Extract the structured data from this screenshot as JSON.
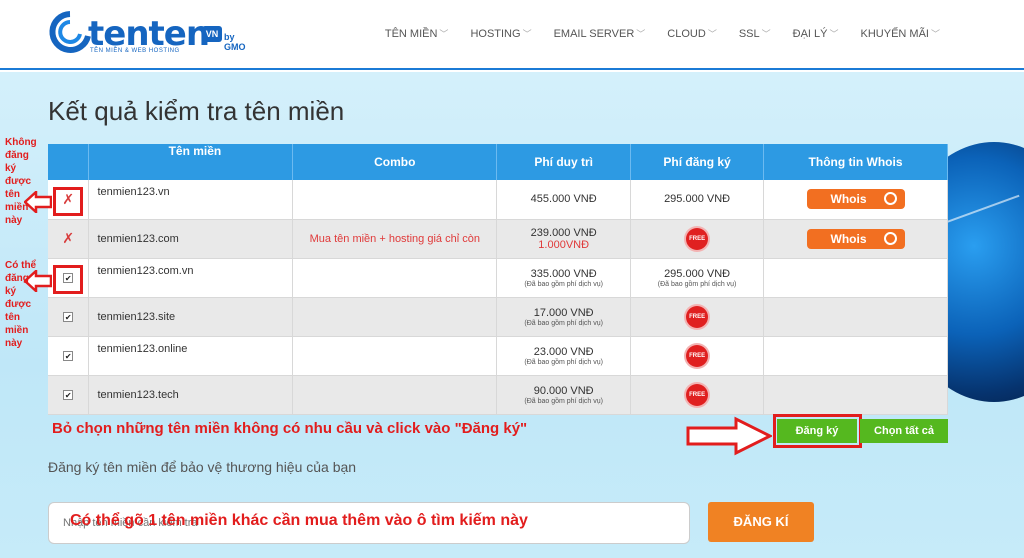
{
  "brand": {
    "logo_text": "tenten",
    "logo_badge": "VN",
    "logo_gmo": "by GMO",
    "tagline": "TÊN MIỀN & WEB HOSTING"
  },
  "nav": [
    {
      "label": "TÊN MIỀN"
    },
    {
      "label": "HOSTING"
    },
    {
      "label": "EMAIL SERVER"
    },
    {
      "label": "CLOUD"
    },
    {
      "label": "SSL"
    },
    {
      "label": "ĐẠI LÝ"
    },
    {
      "label": "KHUYẾN MÃI"
    }
  ],
  "page_title": "Kết quả kiểm tra tên miền",
  "table": {
    "headers": [
      "",
      "Tên miền",
      "Combo",
      "Phí duy trì",
      "Phí đăng ký",
      "Thông tin Whois"
    ],
    "rows": [
      {
        "status": "unavailable",
        "domain": "tenmien123.vn",
        "combo": "",
        "fee": "455.000 VNĐ",
        "fee_note": "",
        "fee2": "",
        "reg": "295.000 VNĐ",
        "reg_note": "",
        "free": false,
        "whois": "Whois"
      },
      {
        "status": "unavailable",
        "domain": "tenmien123.com",
        "combo": "Mua tên miền + hosting giá chỉ còn",
        "fee": "239.000 VNĐ",
        "fee_note": "",
        "fee2": "1.000VNĐ",
        "reg": "",
        "reg_note": "",
        "free": true,
        "free_label": "FREE",
        "whois": "Whois"
      },
      {
        "status": "available",
        "domain": "tenmien123.com.vn",
        "combo": "",
        "fee": "335.000 VNĐ",
        "fee_note": "(Đã bao gồm phí dịch vụ)",
        "fee2": "",
        "reg": "295.000 VNĐ",
        "reg_note": "(Đã bao gồm phí dịch vụ)",
        "free": false,
        "whois": ""
      },
      {
        "status": "available",
        "domain": "tenmien123.site",
        "combo": "",
        "fee": "17.000 VNĐ",
        "fee_note": "(Đã bao gồm phí dịch vụ)",
        "fee2": "",
        "reg": "",
        "reg_note": "",
        "free": true,
        "free_label": "FREE",
        "whois": ""
      },
      {
        "status": "available",
        "domain": "tenmien123.online",
        "combo": "",
        "fee": "23.000 VNĐ",
        "fee_note": "(Đã bao gồm phí dịch vụ)",
        "fee2": "",
        "reg": "",
        "reg_note": "",
        "free": true,
        "free_label": "FREE",
        "whois": ""
      },
      {
        "status": "available",
        "domain": "tenmien123.tech",
        "combo": "",
        "fee": "90.000 VNĐ",
        "fee_note": "(Đã bao gồm phí dịch vụ)",
        "fee2": "",
        "reg": "",
        "reg_note": "",
        "free": true,
        "free_label": "FREE",
        "whois": ""
      }
    ]
  },
  "annotations": {
    "not_available": "Không đăng ký được tên miền này",
    "available": "Có thể đăng ký được tên miền này",
    "instruction": "Bỏ chọn những tên miền không có nhu cầu và click vào \"Đăng ký\"",
    "search_hint": "Có thể gõ 1 tên miền khác cần mua thêm vào ô tìm kiếm này"
  },
  "buttons": {
    "register": "Đăng ký",
    "select_all": "Chọn tất cả",
    "dangki": "ĐĂNG KÍ"
  },
  "protect_text": "Đăng ký tên miền để bảo vệ thương hiệu của bạn",
  "search": {
    "placeholder": "Nhập tên miền cần kiểm tra"
  },
  "colors": {
    "accent": "#2d9ae3",
    "orange": "#f26f21",
    "green": "#55b81f",
    "annotation_red": "#e21d1d"
  }
}
